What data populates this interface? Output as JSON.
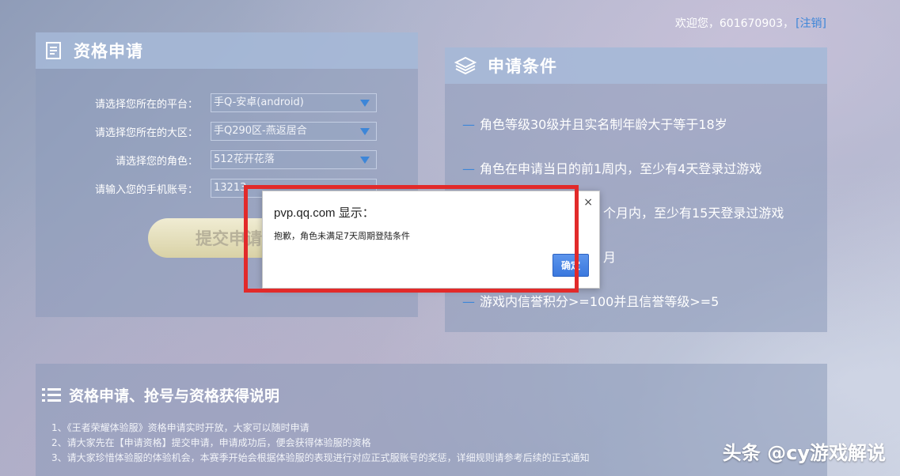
{
  "header": {
    "welcome_text": "欢迎您，601670903，",
    "logout_label": "[注销]"
  },
  "apply_panel": {
    "title": "资格申请",
    "platform": {
      "label": "请选择您所在的平台：",
      "value": "手Q-安卓(android)"
    },
    "region": {
      "label": "请选择您所在的大区：",
      "value": "手Q290区-燕返居合"
    },
    "role": {
      "label": "请选择您的角色：",
      "value": "512花开花落"
    },
    "phone": {
      "label": "请输入您的手机账号：",
      "value": "13213"
    },
    "submit_label": "提交申请"
  },
  "conditions_panel": {
    "title": "申请条件",
    "items": [
      "角色等级30级并且实名制年龄大于等于18岁",
      "角色在申请当日的前1周内，至少有4天登录过游戏",
      "个月内，至少有15天登录过游戏",
      "月",
      "游戏内信誉积分>=100并且信誉等级>=5"
    ]
  },
  "info_panel": {
    "title": "资格申请、抢号与资格获得说明",
    "notes": [
      "1、《王者荣耀体验服》资格申请实时开放，大家可以随时申请",
      "2、请大家先在【申请资格】提交申请，申请成功后，便会获得体验服的资格",
      "3、请大家珍惜体验服的体验机会，本赛季开始会根据体验服的表现进行对应正式服账号的奖惩，详细规则请参考后续的正式通知"
    ]
  },
  "dialog": {
    "title": "pvp.qq.com 显示：",
    "message": "抱歉，角色未满足7天周期登陆条件",
    "ok_label": "确定",
    "close_glyph": "×"
  },
  "watermark": "头条 @cy游戏解说",
  "colors": {
    "accent_blue": "#3d86d8",
    "highlight_red": "#e22a2a",
    "dialog_button": "#3a78de"
  }
}
